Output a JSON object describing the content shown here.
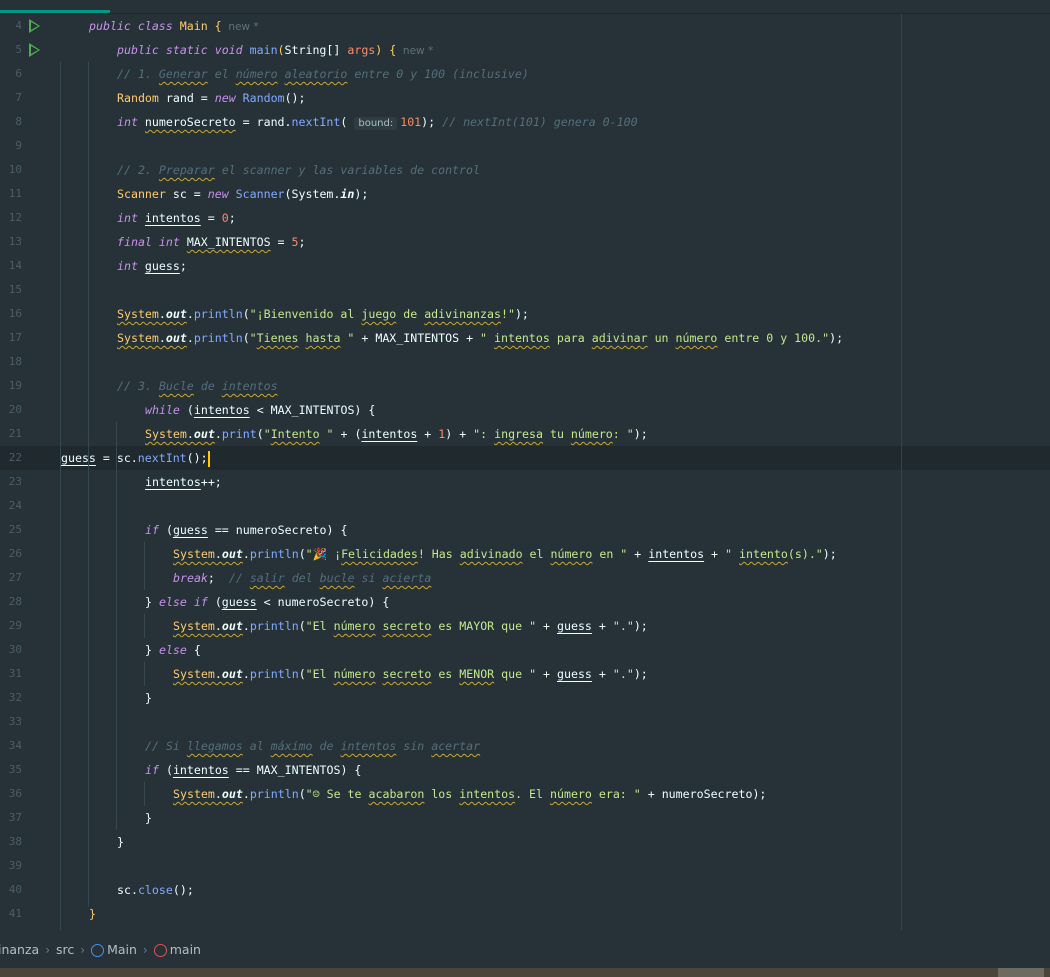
{
  "lines": [
    {
      "n": "4",
      "i": 0,
      "run": true,
      "t": [
        [
          "k",
          "public class "
        ],
        [
          "t",
          "Main "
        ],
        [
          "t",
          "{"
        ],
        [
          "h",
          "  new *"
        ]
      ]
    },
    {
      "n": "5",
      "i": 1,
      "run": true,
      "t": [
        [
          "k",
          "public static void "
        ],
        [
          "m",
          "main"
        ],
        [
          "t",
          "("
        ],
        [
          "v",
          "String[] "
        ],
        [
          "a",
          "args"
        ],
        [
          "t",
          ") {"
        ],
        [
          "h",
          "  new *"
        ]
      ]
    },
    {
      "n": "6",
      "i": 2,
      "t": [
        [
          "c",
          "// 1. "
        ],
        [
          "c w",
          "Generar"
        ],
        [
          "c",
          " el "
        ],
        [
          "c w",
          "número"
        ],
        [
          "c",
          " "
        ],
        [
          "c w",
          "aleatorio"
        ],
        [
          "c",
          " entre 0 y 100 (inclusive)"
        ]
      ]
    },
    {
      "n": "7",
      "i": 2,
      "t": [
        [
          "t",
          "Random "
        ],
        [
          "v",
          "rand = "
        ],
        [
          "k",
          "new "
        ],
        [
          "m",
          "Random"
        ],
        [
          "v",
          "();"
        ]
      ]
    },
    {
      "n": "8",
      "i": 2,
      "t": [
        [
          "k",
          "int "
        ],
        [
          "v w",
          "numeroSecreto"
        ],
        [
          "v",
          " = rand."
        ],
        [
          "m",
          "nextInt"
        ],
        [
          "v",
          "( "
        ],
        [
          "hint",
          "bound:"
        ],
        [
          "n",
          "101"
        ],
        [
          "v",
          "); "
        ],
        [
          "c",
          "// nextInt(101) genera 0-100"
        ]
      ]
    },
    {
      "n": "9",
      "i": 2,
      "t": []
    },
    {
      "n": "10",
      "i": 2,
      "t": [
        [
          "c",
          "// 2. "
        ],
        [
          "c w",
          "Preparar"
        ],
        [
          "c",
          " el scanner y las variables de control"
        ]
      ]
    },
    {
      "n": "11",
      "i": 2,
      "t": [
        [
          "t",
          "Scanner "
        ],
        [
          "v",
          "sc = "
        ],
        [
          "k",
          "new "
        ],
        [
          "m",
          "Scanner"
        ],
        [
          "v",
          "(System."
        ],
        [
          "f",
          "in"
        ],
        [
          "v",
          ");"
        ]
      ]
    },
    {
      "n": "12",
      "i": 2,
      "t": [
        [
          "k",
          "int "
        ],
        [
          "v u",
          "intentos"
        ],
        [
          "v",
          " = "
        ],
        [
          "n",
          "0"
        ],
        [
          "v",
          ";"
        ]
      ]
    },
    {
      "n": "13",
      "i": 2,
      "t": [
        [
          "k",
          "final int "
        ],
        [
          "v w",
          "MAX_INTENTOS"
        ],
        [
          "v",
          " = "
        ],
        [
          "n",
          "5"
        ],
        [
          "v",
          ";"
        ]
      ]
    },
    {
      "n": "14",
      "i": 2,
      "t": [
        [
          "k",
          "int "
        ],
        [
          "v u",
          "guess"
        ],
        [
          "v",
          ";"
        ]
      ]
    },
    {
      "n": "15",
      "i": 2,
      "t": []
    },
    {
      "n": "16",
      "i": 2,
      "t": [
        [
          "t w",
          "System"
        ],
        [
          "v w",
          "."
        ],
        [
          "f w",
          "out"
        ],
        [
          "v",
          "."
        ],
        [
          "m",
          "println"
        ],
        [
          "v",
          "("
        ],
        [
          "s",
          "\"¡Bienvenido al "
        ],
        [
          "s w",
          "juego"
        ],
        [
          "s",
          " de "
        ],
        [
          "s w",
          "adivinanzas"
        ],
        [
          "s",
          "!\""
        ],
        [
          "v",
          ");"
        ]
      ]
    },
    {
      "n": "17",
      "i": 2,
      "t": [
        [
          "t w",
          "System"
        ],
        [
          "v w",
          "."
        ],
        [
          "f w",
          "out"
        ],
        [
          "v",
          "."
        ],
        [
          "m",
          "println"
        ],
        [
          "v",
          "("
        ],
        [
          "s",
          "\""
        ],
        [
          "s w",
          "Tienes"
        ],
        [
          "s",
          " "
        ],
        [
          "s w",
          "hasta"
        ],
        [
          "s",
          " \""
        ],
        [
          "v",
          " + MAX_INTENTOS + "
        ],
        [
          "s",
          "\" "
        ],
        [
          "s w",
          "intentos"
        ],
        [
          "s",
          " para "
        ],
        [
          "s w",
          "adivinar"
        ],
        [
          "s",
          " un "
        ],
        [
          "s w",
          "número"
        ],
        [
          "s",
          " entre 0 y 100.\""
        ],
        [
          "v",
          ");"
        ]
      ]
    },
    {
      "n": "18",
      "i": 2,
      "t": []
    },
    {
      "n": "19",
      "i": 2,
      "t": [
        [
          "c",
          "// 3. "
        ],
        [
          "c w",
          "Bucle"
        ],
        [
          "c",
          " de "
        ],
        [
          "c w",
          "intentos"
        ]
      ]
    },
    {
      "n": "20",
      "i": 2,
      "t": [
        [
          "k",
          "while "
        ],
        [
          "v",
          "("
        ],
        [
          "v u",
          "intentos"
        ],
        [
          "v",
          " < MAX_INTENTOS) {"
        ]
      ]
    },
    {
      "n": "21",
      "i": 3,
      "t": [
        [
          "t w",
          "System"
        ],
        [
          "v w",
          "."
        ],
        [
          "f w",
          "out"
        ],
        [
          "v",
          "."
        ],
        [
          "m",
          "print"
        ],
        [
          "v",
          "("
        ],
        [
          "s",
          "\""
        ],
        [
          "s w",
          "Intento"
        ],
        [
          "s",
          " \""
        ],
        [
          "v",
          " + ("
        ],
        [
          "v u",
          "intentos"
        ],
        [
          "v",
          " + "
        ],
        [
          "n",
          "1"
        ],
        [
          "v",
          ") + "
        ],
        [
          "s",
          "\": "
        ],
        [
          "s w",
          "ingresa"
        ],
        [
          "s",
          " tu "
        ],
        [
          "s w",
          "número"
        ],
        [
          "s",
          ": \""
        ],
        [
          "v",
          ");"
        ]
      ]
    },
    {
      "n": "22",
      "i": 3,
      "current": true,
      "t": [
        [
          "v u",
          "guess"
        ],
        [
          "v",
          " = sc."
        ],
        [
          "m",
          "nextInt"
        ],
        [
          "v",
          "();"
        ]
      ]
    },
    {
      "n": "23",
      "i": 3,
      "t": [
        [
          "v u",
          "intentos"
        ],
        [
          "v",
          "++;"
        ]
      ]
    },
    {
      "n": "24",
      "i": 3,
      "t": []
    },
    {
      "n": "25",
      "i": 3,
      "t": [
        [
          "k",
          "if "
        ],
        [
          "v",
          "("
        ],
        [
          "v u",
          "guess"
        ],
        [
          "v",
          " == numeroSecreto) {"
        ]
      ]
    },
    {
      "n": "26",
      "i": 4,
      "t": [
        [
          "t w",
          "System"
        ],
        [
          "v w",
          "."
        ],
        [
          "f w",
          "out"
        ],
        [
          "v",
          "."
        ],
        [
          "m",
          "println"
        ],
        [
          "v",
          "("
        ],
        [
          "s",
          "\"🎉 ¡"
        ],
        [
          "s w",
          "Felicidades"
        ],
        [
          "s",
          "! Has "
        ],
        [
          "s w",
          "adivinado"
        ],
        [
          "s",
          " el "
        ],
        [
          "s w",
          "número"
        ],
        [
          "s",
          " en \""
        ],
        [
          "v",
          " + "
        ],
        [
          "v u",
          "intentos"
        ],
        [
          "v",
          " + "
        ],
        [
          "s",
          "\" "
        ],
        [
          "s w",
          "intento"
        ],
        [
          "s",
          "(s).\""
        ],
        [
          "v",
          ");"
        ]
      ]
    },
    {
      "n": "27",
      "i": 4,
      "t": [
        [
          "k",
          "break"
        ],
        [
          "v",
          ";  "
        ],
        [
          "c",
          "// "
        ],
        [
          "c w",
          "salir"
        ],
        [
          "c",
          " del "
        ],
        [
          "c w",
          "bucle"
        ],
        [
          "c",
          " si "
        ],
        [
          "c w",
          "acierta"
        ]
      ]
    },
    {
      "n": "28",
      "i": 3,
      "t": [
        [
          "v",
          "} "
        ],
        [
          "k",
          "else if "
        ],
        [
          "v",
          "("
        ],
        [
          "v u",
          "guess"
        ],
        [
          "v",
          " < numeroSecreto) {"
        ]
      ]
    },
    {
      "n": "29",
      "i": 4,
      "t": [
        [
          "t w",
          "System"
        ],
        [
          "v w",
          "."
        ],
        [
          "f w",
          "out"
        ],
        [
          "v",
          "."
        ],
        [
          "m",
          "println"
        ],
        [
          "v",
          "("
        ],
        [
          "s",
          "\"El "
        ],
        [
          "s w",
          "número"
        ],
        [
          "s",
          " "
        ],
        [
          "s w",
          "secreto"
        ],
        [
          "s",
          " es MAYOR que \""
        ],
        [
          "v",
          " + "
        ],
        [
          "v u",
          "guess"
        ],
        [
          "v",
          " + "
        ],
        [
          "s",
          "\".\""
        ],
        [
          "v",
          ");"
        ]
      ]
    },
    {
      "n": "30",
      "i": 3,
      "t": [
        [
          "v",
          "} "
        ],
        [
          "k",
          "else "
        ],
        [
          "v",
          "{"
        ]
      ]
    },
    {
      "n": "31",
      "i": 4,
      "t": [
        [
          "t w",
          "System"
        ],
        [
          "v w",
          "."
        ],
        [
          "f w",
          "out"
        ],
        [
          "v",
          "."
        ],
        [
          "m",
          "println"
        ],
        [
          "v",
          "("
        ],
        [
          "s",
          "\"El "
        ],
        [
          "s w",
          "número"
        ],
        [
          "s",
          " "
        ],
        [
          "s w",
          "secreto"
        ],
        [
          "s",
          " es "
        ],
        [
          "s w",
          "MENOR"
        ],
        [
          "s",
          " que \""
        ],
        [
          "v",
          " + "
        ],
        [
          "v u",
          "guess"
        ],
        [
          "v",
          " + "
        ],
        [
          "s",
          "\".\""
        ],
        [
          "v",
          ");"
        ]
      ]
    },
    {
      "n": "32",
      "i": 3,
      "t": [
        [
          "v",
          "}"
        ]
      ]
    },
    {
      "n": "33",
      "i": 3,
      "t": []
    },
    {
      "n": "34",
      "i": 3,
      "t": [
        [
          "c",
          "// Si "
        ],
        [
          "c w",
          "llegamos"
        ],
        [
          "c",
          " al "
        ],
        [
          "c w",
          "máximo"
        ],
        [
          "c",
          " de "
        ],
        [
          "c w",
          "intentos"
        ],
        [
          "c",
          " sin "
        ],
        [
          "c w",
          "acertar"
        ]
      ]
    },
    {
      "n": "35",
      "i": 3,
      "t": [
        [
          "k",
          "if "
        ],
        [
          "v",
          "("
        ],
        [
          "v u",
          "intentos"
        ],
        [
          "v",
          " == MAX_INTENTOS) {"
        ]
      ]
    },
    {
      "n": "36",
      "i": 4,
      "t": [
        [
          "t w",
          "System"
        ],
        [
          "v w",
          "."
        ],
        [
          "f w",
          "out"
        ],
        [
          "v",
          "."
        ],
        [
          "m",
          "println"
        ],
        [
          "v",
          "("
        ],
        [
          "s",
          "\"☹ Se te "
        ],
        [
          "s w",
          "acabaron"
        ],
        [
          "s",
          " los "
        ],
        [
          "s w",
          "intentos"
        ],
        [
          "s",
          ". El "
        ],
        [
          "s w",
          "número"
        ],
        [
          "s",
          " era: \""
        ],
        [
          "v",
          " + numeroSecreto);"
        ]
      ]
    },
    {
      "n": "37",
      "i": 3,
      "t": [
        [
          "v",
          "}"
        ]
      ]
    },
    {
      "n": "38",
      "i": 2,
      "t": [
        [
          "v",
          "}"
        ]
      ]
    },
    {
      "n": "39",
      "i": 2,
      "t": []
    },
    {
      "n": "40",
      "i": 2,
      "t": [
        [
          "v",
          "sc."
        ],
        [
          "m",
          "close"
        ],
        [
          "v",
          "();"
        ]
      ]
    },
    {
      "n": "41",
      "i": 1,
      "t": [
        [
          "t",
          "}"
        ]
      ]
    }
  ],
  "breadcrumb": {
    "project": "inanza",
    "folder": "src",
    "class": "Main",
    "method": "main"
  },
  "colors": {
    "background": "#263238",
    "keyword": "#c792ea",
    "type": "#ffcb6b",
    "method": "#82aaff",
    "string": "#c3e88d",
    "number": "#f78c6c",
    "comment": "#546e7a",
    "caret": "#ffcc00"
  }
}
